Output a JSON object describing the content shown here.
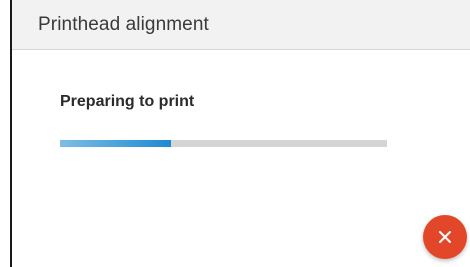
{
  "header": {
    "title": "Printhead alignment"
  },
  "main": {
    "status": "Preparing to print",
    "progress": 0.34
  },
  "actions": {
    "cancel_icon": "close-icon",
    "cancel_color": "#e3472a"
  },
  "colors": {
    "accent": "#1c8ad3",
    "track": "#d4d4d4"
  }
}
